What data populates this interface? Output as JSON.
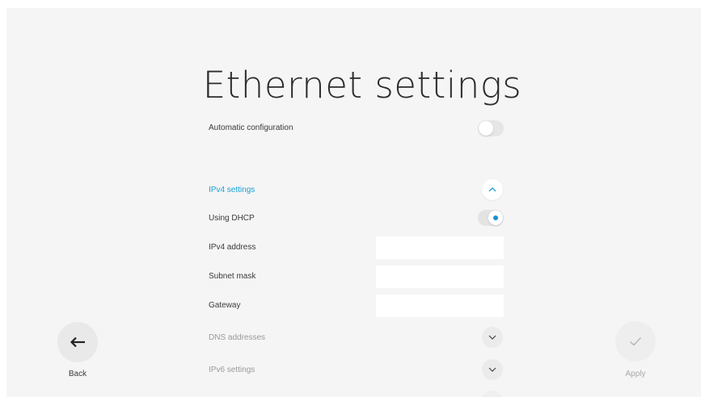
{
  "page": {
    "title": "Ethernet settings"
  },
  "settings": {
    "automatic_configuration": {
      "label": "Automatic configuration",
      "enabled": false
    },
    "ipv4_section": {
      "label": "IPv4 settings",
      "expanded": true
    },
    "using_dhcp": {
      "label": "Using DHCP",
      "enabled": true
    },
    "ipv4_address": {
      "label": "IPv4 address",
      "value": ""
    },
    "subnet_mask": {
      "label": "Subnet mask",
      "value": ""
    },
    "gateway": {
      "label": "Gateway",
      "value": ""
    },
    "dns_section": {
      "label": "DNS addresses",
      "expanded": false
    },
    "ipv6_section": {
      "label": "IPv6 settings",
      "expanded": false
    }
  },
  "actions": {
    "back": {
      "label": "Back",
      "icon": "arrow-left-icon"
    },
    "apply": {
      "label": "Apply",
      "icon": "checkmark-icon",
      "enabled": false
    }
  },
  "colors": {
    "accent": "#1aa0d6",
    "background": "#f5f5f5"
  }
}
